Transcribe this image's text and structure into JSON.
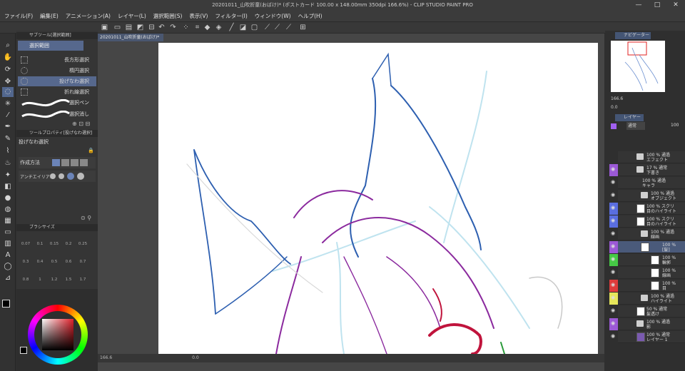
{
  "window": {
    "title": "20201011_山吹折童(おばけ)* (ポストカード 100.00 x 148.00mm 350dpi 166.6%) - CLIP STUDIO PAINT PRO",
    "minimize": "—",
    "maximize": "□",
    "close": "✕"
  },
  "menu": [
    "ファイル(F)",
    "編集(E)",
    "アニメーション(A)",
    "レイヤー(L)",
    "選択範囲(S)",
    "表示(V)",
    "フィルター(I)",
    "ウィンドウ(W)",
    "ヘルプ(H)"
  ],
  "subtool": {
    "header": "サブツール[選択範囲]",
    "group": "選択範囲",
    "items": [
      "長方形選択",
      "楕円選択",
      "投げなわ選択",
      "折れ線選択",
      "選択ペン",
      "選択消し"
    ]
  },
  "toolprop": {
    "header": "ツールプロパティ[投げなわ選択]",
    "title": "投げなわ選択",
    "mode_label": "作成方法",
    "aa_label": "アンチエイリアス"
  },
  "brushsize": {
    "header": "ブラシサイズ",
    "values": [
      "0.07",
      "0.1",
      "0.15",
      "0.2",
      "0.25",
      "0.3",
      "0.4",
      "0.5",
      "0.6",
      "0.7",
      "0.8",
      "1",
      "1.2",
      "1.5",
      "1.7"
    ]
  },
  "document": {
    "tab": "20201011_山吹折童(おばけ)*",
    "zoom": "166.6",
    "angle": "0.0"
  },
  "navigator": {
    "header": "ナビゲーター",
    "zoom": "166.6",
    "angle": "0.0"
  },
  "layers": {
    "header": "レイヤー",
    "blend": "通常",
    "opacity": "100",
    "rows": [
      {
        "name": "100 % 通過\nエフェクト",
        "color": "#2f2f2f"
      },
      {
        "name": "17 % 通常\n下書き",
        "color": "#9b59d6"
      },
      {
        "name": "100 % 通過\nキャラ",
        "color": "#2f2f2f"
      },
      {
        "name": "100 % 通過\nオブジェクト",
        "color": "#2f2f2f"
      },
      {
        "name": "100 % スクリ\n目のハイライト",
        "color": "#5a6ee0"
      },
      {
        "name": "100 % スクリ\n目のハイライト",
        "color": "#5a6ee0"
      },
      {
        "name": "100 % 通過\n線画",
        "color": "#2f2f2f"
      },
      {
        "name": "100 % \n[髪]",
        "color": "#9b59d6"
      },
      {
        "name": "100 % \n輪郭",
        "color": "#46c946"
      },
      {
        "name": "100 % \n線画",
        "color": "#2f2f2f"
      },
      {
        "name": "100 % \n目",
        "color": "#e03b3b"
      },
      {
        "name": "100 % 通過\nハイライト",
        "color": "#e6e65a"
      },
      {
        "name": "50 % 通常\n髪透け",
        "color": "#2f2f2f"
      },
      {
        "name": "100 % 通過\n影",
        "color": "#9b59d6"
      },
      {
        "name": "100 % 通常\nレイヤー 1",
        "color": "#2f2f2f"
      }
    ]
  },
  "colors": {
    "accent": "#56688d",
    "main_color": "#000000",
    "sub_color": "#ffffff",
    "line_blue": "#2d5fb0",
    "line_purple": "#8b2a9e",
    "line_light": "#bfe3ef",
    "line_red": "#c0143c"
  }
}
